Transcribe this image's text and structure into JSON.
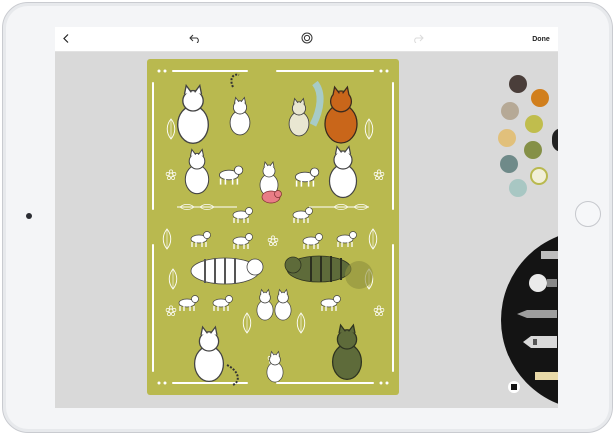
{
  "toolbar": {
    "back_icon": "chevron-left-icon",
    "undo_icon": "undo-icon",
    "layers_icon": "target-icon",
    "redo_icon": "redo-icon",
    "done_label": "Done"
  },
  "colors": {
    "canvas": "#b9b94f",
    "swatches": [
      "#4a3e3a",
      "#d17f1d",
      "#b6a996",
      "#c0bd4d",
      "#e1c07b",
      "#859047",
      "#6f8a89",
      "#f1efd8",
      "#a8c7c3"
    ]
  },
  "tools": [
    "marker-tool",
    "brush-tool",
    "pencil-tool",
    "ink-tool",
    "crayon-tool"
  ]
}
